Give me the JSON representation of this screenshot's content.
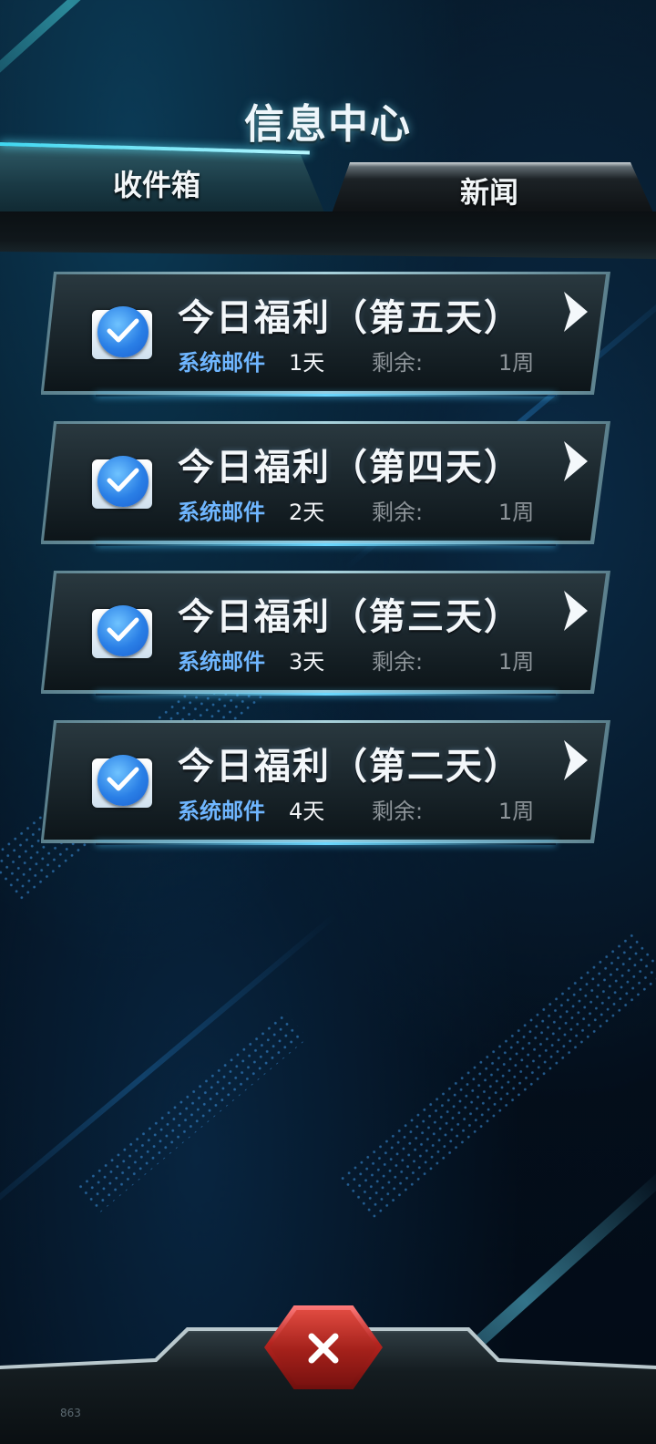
{
  "header": {
    "title": "信息中心"
  },
  "tabs": [
    {
      "label": "收件箱",
      "active": true
    },
    {
      "label": "新闻",
      "active": false
    }
  ],
  "mails": [
    {
      "title": "今日福利（第五天）",
      "type": "系统邮件",
      "age": "1天",
      "remain_label": "剩余:",
      "remain_value": "1周"
    },
    {
      "title": "今日福利（第四天）",
      "type": "系统邮件",
      "age": "2天",
      "remain_label": "剩余:",
      "remain_value": "1周"
    },
    {
      "title": "今日福利（第三天）",
      "type": "系统邮件",
      "age": "3天",
      "remain_label": "剩余:",
      "remain_value": "1周"
    },
    {
      "title": "今日福利（第二天）",
      "type": "系统邮件",
      "age": "4天",
      "remain_label": "剩余:",
      "remain_value": "1周"
    }
  ],
  "icons": {
    "mail": "check-mail-icon",
    "open": "chevron-right-icon",
    "close": "close-icon"
  },
  "footer": {
    "code": "863"
  },
  "colors": {
    "accent": "#5ee7ff",
    "type_text": "#6fb6ff",
    "close_button": "#b5241f"
  }
}
